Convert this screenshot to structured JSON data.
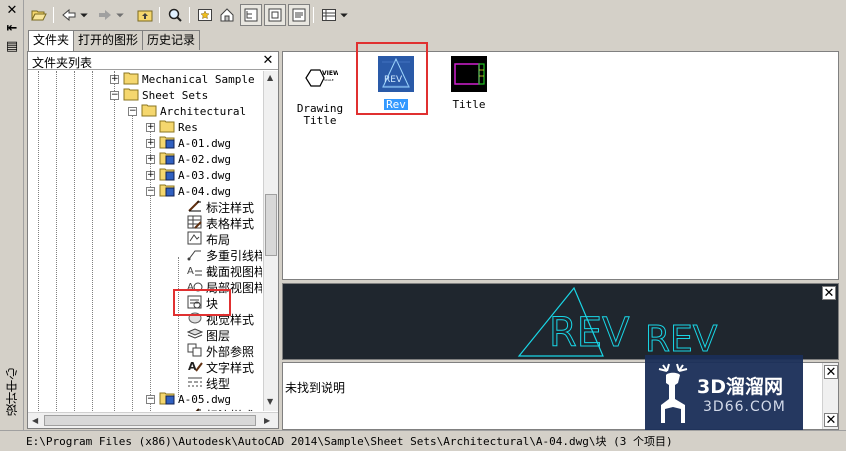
{
  "window": {
    "vertical_title": "设计中心"
  },
  "tabs": [
    {
      "label": "文件夹",
      "active": true
    },
    {
      "label": "打开的图形",
      "active": false
    },
    {
      "label": "历史记录",
      "active": false
    }
  ],
  "folder_pane": {
    "title": "文件夹列表",
    "tree": [
      {
        "label": "Mechanical Sample",
        "type": "folder",
        "level": 5
      },
      {
        "label": "Sheet Sets",
        "type": "folder",
        "level": 5,
        "expanded": true
      },
      {
        "label": "Architectural",
        "type": "folder",
        "level": 6,
        "expanded": true
      },
      {
        "label": "Res",
        "type": "folder",
        "level": 7
      },
      {
        "label": "A-01.dwg",
        "type": "dwg",
        "level": 7
      },
      {
        "label": "A-02.dwg",
        "type": "dwg",
        "level": 7
      },
      {
        "label": "A-03.dwg",
        "type": "dwg",
        "level": 7
      },
      {
        "label": "A-04.dwg",
        "type": "dwg",
        "level": 7,
        "expanded": true
      },
      {
        "label": "标注样式",
        "type": "dimstyle",
        "level": 8
      },
      {
        "label": "表格样式",
        "type": "tablestyle",
        "level": 8
      },
      {
        "label": "布局",
        "type": "layout",
        "level": 8
      },
      {
        "label": "多重引线样",
        "type": "mleader",
        "level": 8
      },
      {
        "label": "截面视图样",
        "type": "section",
        "level": 8
      },
      {
        "label": "局部视图样",
        "type": "detail",
        "level": 8
      },
      {
        "label": "块",
        "type": "block",
        "level": 8,
        "highlighted": true
      },
      {
        "label": "视觉样式",
        "type": "visualstyle",
        "level": 8
      },
      {
        "label": "图层",
        "type": "layer",
        "level": 8
      },
      {
        "label": "外部参照",
        "type": "xref",
        "level": 8
      },
      {
        "label": "文字样式",
        "type": "textstyle",
        "level": 8
      },
      {
        "label": "线型",
        "type": "linetype",
        "level": 8
      },
      {
        "label": "A-05.dwg",
        "type": "dwg",
        "level": 7,
        "expanded": true
      },
      {
        "label": "标注样式",
        "type": "dimstyle",
        "level": 8
      }
    ]
  },
  "content": {
    "items": [
      {
        "name": "Drawing Title",
        "line1": "Drawing",
        "line2": "Title",
        "selected": false
      },
      {
        "name": "Rev",
        "line1": "Rev",
        "line2": "",
        "selected": true
      },
      {
        "name": "Title",
        "line1": "Title",
        "line2": "",
        "selected": false
      }
    ]
  },
  "preview": {
    "text_left": "REV",
    "text_right": "REV",
    "line_color": "#19d6e6"
  },
  "description": {
    "text": "未找到说明"
  },
  "watermark": {
    "line1": "3D溜溜网",
    "line2": "3D66.COM"
  },
  "status": {
    "path": "E:\\Program Files (x86)\\Autodesk\\AutoCAD 2014\\Sample\\Sheet Sets\\Architectural\\A-04.dwg\\块 (3 个项目)"
  },
  "colors": {
    "highlight_box": "#e03030",
    "selection": "#3399ff",
    "preview_bg": "#1f262e"
  }
}
